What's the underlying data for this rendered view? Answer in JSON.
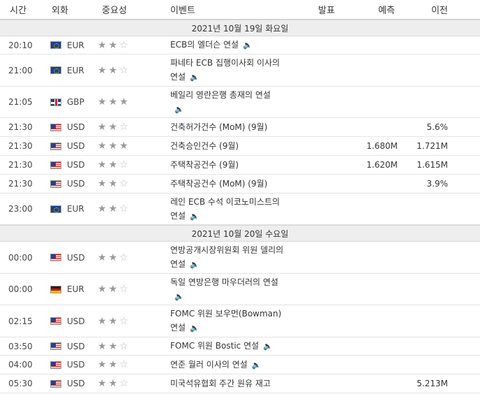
{
  "header": {
    "time": "시간",
    "currency": "외화",
    "importance": "중요성",
    "event": "이벤트",
    "actual": "발표",
    "forecast": "예측",
    "previous": "이전"
  },
  "dates": [
    "2021년 10월 19일 화요일",
    "2021년 10월 20일 수요일"
  ],
  "day1": [
    {
      "time": "20:10",
      "cur": "EUR",
      "flag": "eu",
      "stars": 2,
      "event": [
        "ECB의 엘더슨 연설"
      ],
      "speaker": true,
      "actual": "",
      "forecast": "",
      "previous": ""
    },
    {
      "time": "21:00",
      "cur": "EUR",
      "flag": "eu",
      "stars": 2,
      "event": [
        "파네타 ECB 집행이사회 이사의",
        "연설"
      ],
      "speaker": true,
      "actual": "",
      "forecast": "",
      "previous": ""
    },
    {
      "time": "21:05",
      "cur": "GBP",
      "flag": "gb",
      "stars": 3,
      "event": [
        "베일리 영란은행 총재의 연설",
        ""
      ],
      "speaker": true,
      "actual": "",
      "forecast": "",
      "previous": ""
    },
    {
      "time": "21:30",
      "cur": "USD",
      "flag": "us",
      "stars": 2,
      "event": [
        "건축허가건수 (MoM) (9월)"
      ],
      "speaker": false,
      "actual": "",
      "forecast": "",
      "previous": "5.6%"
    },
    {
      "time": "21:30",
      "cur": "USD",
      "flag": "us",
      "stars": 3,
      "event": [
        "건축승인건수 (9월)"
      ],
      "speaker": false,
      "actual": "",
      "forecast": "1.680M",
      "previous": "1.721M"
    },
    {
      "time": "21:30",
      "cur": "USD",
      "flag": "us",
      "stars": 2,
      "event": [
        "주택착공건수 (9월)"
      ],
      "speaker": false,
      "actual": "",
      "forecast": "1.620M",
      "previous": "1.615M"
    },
    {
      "time": "21:30",
      "cur": "USD",
      "flag": "us",
      "stars": 2,
      "event": [
        "주택착공건수 (MoM) (9월)"
      ],
      "speaker": false,
      "actual": "",
      "forecast": "",
      "previous": "3.9%"
    },
    {
      "time": "23:00",
      "cur": "EUR",
      "flag": "eu",
      "stars": 2,
      "event": [
        "레인 ECB 수석 이코노미스트의",
        "연설"
      ],
      "speaker": true,
      "actual": "",
      "forecast": "",
      "previous": ""
    }
  ],
  "day2": [
    {
      "time": "00:00",
      "cur": "USD",
      "flag": "us",
      "stars": 2,
      "event": [
        "연방공개시장위원회 위원 델리의",
        "연설"
      ],
      "speaker": true,
      "actual": "",
      "forecast": "",
      "previous": ""
    },
    {
      "time": "00:00",
      "cur": "EUR",
      "flag": "de",
      "stars": 2,
      "event": [
        "독일 연방은행 마우더러의 연설",
        ""
      ],
      "speaker": true,
      "actual": "",
      "forecast": "",
      "previous": ""
    },
    {
      "time": "02:15",
      "cur": "USD",
      "flag": "us",
      "stars": 2,
      "event": [
        "FOMC 위원 보우먼(Bowman)",
        "연설"
      ],
      "speaker": true,
      "actual": "",
      "forecast": "",
      "previous": ""
    },
    {
      "time": "03:50",
      "cur": "USD",
      "flag": "us",
      "stars": 2,
      "event": [
        "FOMC 위원 Bostic 연설"
      ],
      "speaker": true,
      "actual": "",
      "forecast": "",
      "previous": ""
    },
    {
      "time": "04:00",
      "cur": "USD",
      "flag": "us",
      "stars": 2,
      "event": [
        "연준 월러 이사의 연설"
      ],
      "speaker": true,
      "actual": "",
      "forecast": "",
      "previous": ""
    },
    {
      "time": "05:30",
      "cur": "USD",
      "flag": "us",
      "stars": 2,
      "event": [
        "미국석유협회 주간 원유 재고"
      ],
      "speaker": false,
      "actual": "",
      "forecast": "",
      "previous": "5.213M"
    }
  ],
  "icons": {
    "star": "star-icon",
    "speaker": "speaker-icon",
    "flags": [
      "eu-flag-icon",
      "us-flag-icon",
      "gb-flag-icon",
      "de-flag-icon"
    ]
  }
}
